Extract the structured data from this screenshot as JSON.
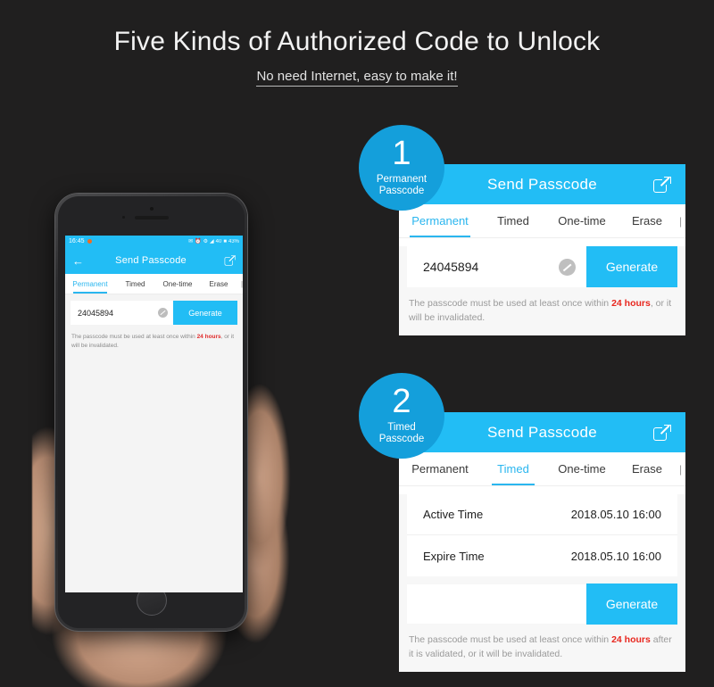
{
  "hero": {
    "title": "Five Kinds of Authorized Code to Unlock",
    "subtitle": "No need Internet, easy to make it!"
  },
  "colors": {
    "background": "#201f1f",
    "accent": "#22bdf5",
    "badge": "#149fdb",
    "warning": "#e8271f",
    "panel": "#f7f7f7"
  },
  "phone": {
    "status": {
      "time": "16:45",
      "signal": "40",
      "battery": "43%"
    },
    "header": {
      "title": "Send Passcode",
      "back_icon": "back-arrow-icon",
      "share_icon": "external-link-icon"
    },
    "tabs": [
      {
        "label": "Permanent",
        "active": true
      },
      {
        "label": "Timed",
        "active": false
      },
      {
        "label": "One-time",
        "active": false
      },
      {
        "label": "Erase",
        "active": false
      },
      {
        "label": "|",
        "active": false
      }
    ],
    "code": "24045894",
    "edit_icon": "edit-pencil-icon",
    "generate_label": "Generate",
    "note_prefix": "The passcode must be used at least once within ",
    "note_highlight": "24 hours",
    "note_suffix": ", or it will be invalidated."
  },
  "panels": [
    {
      "badge": {
        "number": "1",
        "line1": "Permanent",
        "line2": "Passcode"
      },
      "header": {
        "title": "Send Passcode",
        "share_icon": "external-link-icon"
      },
      "tabs": [
        {
          "label": "Permanent",
          "active": true
        },
        {
          "label": "Timed",
          "active": false
        },
        {
          "label": "One-time",
          "active": false
        },
        {
          "label": "Erase",
          "active": false
        },
        {
          "label": "|",
          "active": false
        }
      ],
      "code": "24045894",
      "edit_icon": "edit-pencil-icon",
      "generate_label": "Generate",
      "note_prefix": "The passcode must be used at least once within ",
      "note_highlight": "24 hours",
      "note_suffix": ", or it will be invalidated."
    },
    {
      "badge": {
        "number": "2",
        "line1": "Timed",
        "line2": "Passcode"
      },
      "header": {
        "title": "Send Passcode",
        "share_icon": "external-link-icon"
      },
      "tabs": [
        {
          "label": "Permanent",
          "active": false
        },
        {
          "label": "Timed",
          "active": true
        },
        {
          "label": "One-time",
          "active": false
        },
        {
          "label": "Erase",
          "active": false
        },
        {
          "label": "|",
          "active": false
        }
      ],
      "rows": [
        {
          "key": "Active Time",
          "value": "2018.05.10 16:00"
        },
        {
          "key": "Expire Time",
          "value": "2018.05.10 16:00"
        }
      ],
      "generate_label": "Generate",
      "note_prefix": "The passcode must be used at least once within ",
      "note_highlight": "24 hours",
      "note_suffix": " after it is validated, or it will be invalidated."
    }
  ]
}
